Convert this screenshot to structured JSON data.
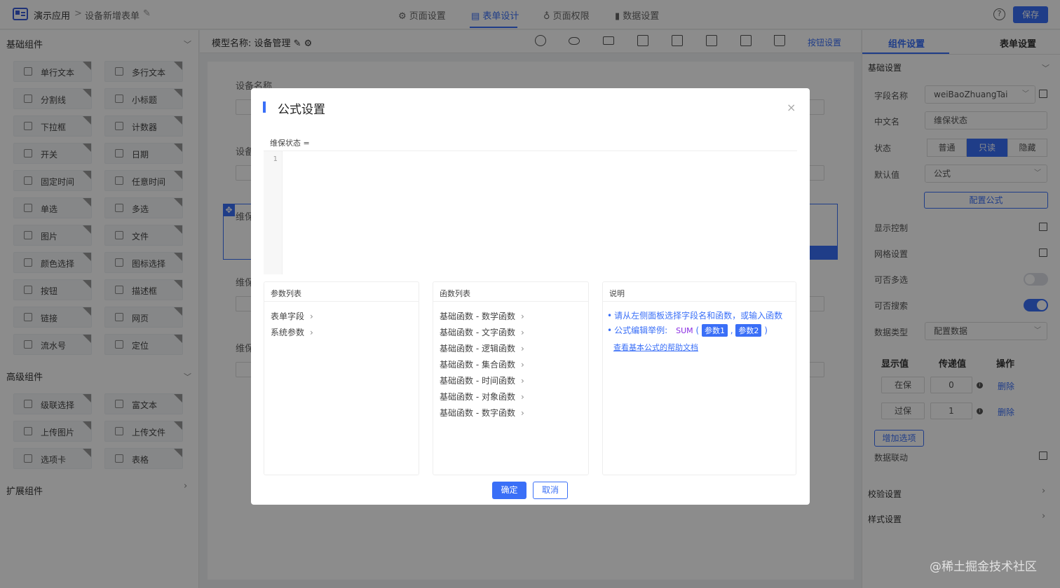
{
  "header": {
    "breadcrumb": [
      "演示应用",
      ">",
      "设备新增表单"
    ],
    "tabs": [
      "页面设置",
      "表单设计",
      "页面权限",
      "数据设置"
    ],
    "active_tab": "表单设计",
    "help_icon": "?",
    "save_label": "保存"
  },
  "left": {
    "sections": {
      "basic": "基础组件",
      "advanced": "高级组件",
      "extended": "扩展组件"
    },
    "basic_items": [
      "单行文本",
      "多行文本",
      "分割线",
      "小标题",
      "下拉框",
      "计数器",
      "开关",
      "日期",
      "固定时间",
      "任意时间",
      "单选",
      "多选",
      "图片",
      "文件",
      "颜色选择",
      "图标选择",
      "按钮",
      "描述框",
      "链接",
      "网页",
      "流水号",
      "定位"
    ],
    "advanced_items": [
      "级联选择",
      "富文本",
      "上传图片",
      "上传文件",
      "选项卡",
      "表格"
    ]
  },
  "center": {
    "model_label": "模型名称: 设备管理",
    "button_settings": "按钮设置",
    "canvas_labels": [
      "设备名称",
      "设备",
      "维保",
      "维保",
      "维保"
    ]
  },
  "right": {
    "tabs": [
      "组件设置",
      "表单设置"
    ],
    "basic_settings": "基础设置",
    "field_name_label": "字段名称",
    "field_name_value": "weiBaoZhuangTai",
    "cn_name_label": "中文名",
    "cn_name_value": "维保状态",
    "status_label": "状态",
    "status_options": [
      "普通",
      "只读",
      "隐藏"
    ],
    "default_label": "默认值",
    "default_value": "公式",
    "config_formula": "配置公式",
    "display_control": "显示控制",
    "grid_settings": "网格设置",
    "multi_select": "可否多选",
    "searchable": "可否搜索",
    "data_type_label": "数据类型",
    "data_type_value": "配置数据",
    "table_headers": [
      "显示值",
      "传递值",
      "操作"
    ],
    "options": [
      {
        "display": "在保",
        "value": "0",
        "action": "删除"
      },
      {
        "display": "过保",
        "value": "1",
        "action": "删除"
      }
    ],
    "add_option": "增加选项",
    "data_linkage": "数据联动",
    "validation": "校验设置",
    "style_settings": "样式设置"
  },
  "modal": {
    "title": "公式设置",
    "close": "×",
    "formula_field": "维保状态 =",
    "line_number": "1",
    "params_title": "参数列表",
    "params": [
      "表单字段",
      "系统参数"
    ],
    "functions_title": "函数列表",
    "functions": [
      "基础函数 - 数学函数",
      "基础函数 - 文字函数",
      "基础函数 - 逻辑函数",
      "基础函数 - 集合函数",
      "基础函数 - 时间函数",
      "基础函数 - 对象函数",
      "基础函数 - 数字函数"
    ],
    "desc_title": "说明",
    "desc_line1": "请从左侧面板选择字段名和函数，或输入函数",
    "desc_line2": "公式编辑举例:",
    "sum": "SUM",
    "param1": "参数1",
    "param2": "参数2",
    "help_link": "查看基本公式的帮助文档",
    "ok": "确定",
    "cancel": "取消"
  },
  "watermark": "@稀土掘金技术社区",
  "colors": {
    "primary": "#3a6ff7",
    "overlay": "rgba(0,0,0,0.45)"
  }
}
